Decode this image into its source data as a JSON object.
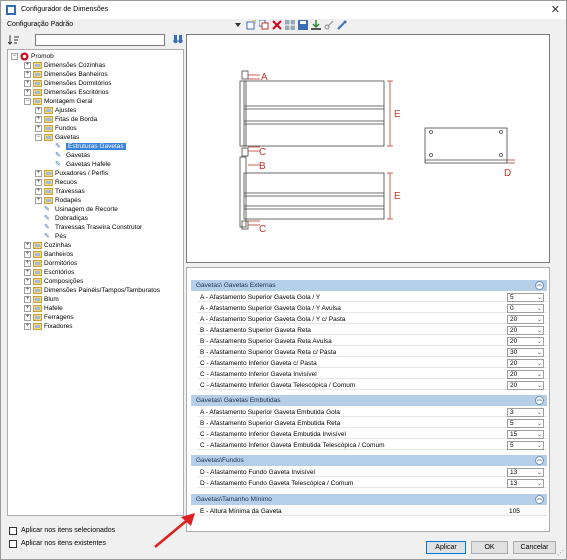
{
  "window": {
    "title": "Configurador de Dimensões",
    "close_glyph": "✕"
  },
  "menu": {
    "label": "Configuração Padrão"
  },
  "toolbar": {
    "icons": [
      "dropdown-arrow-icon",
      "new-icon",
      "copy-icon",
      "delete-icon",
      "grid-icon",
      "save-icon",
      "import-icon",
      "key-icon",
      "tools-icon"
    ]
  },
  "search": {
    "value": "",
    "placeholder": ""
  },
  "tree": {
    "root": "Promob",
    "n1": "Dimensões Cozinhas",
    "n2": "Dimensões Banheiros",
    "n3": "Dimensões Dormitórios",
    "n4": "Dimensões Escritórios",
    "n5": "Montagem Geral",
    "n6": "Ajustes",
    "n7": "Fitas de Borda",
    "n8": "Fundos",
    "n9": "Gavetas",
    "n10": "Estruturas Gavetas",
    "n11": "Gavetas",
    "n12": "Gavetas Hafele",
    "n13": "Puxadores / Perfis",
    "n14": "Recuos",
    "n15": "Travessas",
    "n16": "Rodapés",
    "n17": "Usinagem de Recorte",
    "n18": "Dobradiças",
    "n19": "Travessas Traseira Construtor",
    "n20": "Pés",
    "n21": "Cozinhas",
    "n22": "Banheiros",
    "n23": "Dormitórios",
    "n24": "Escritórios",
    "n25": "Composições",
    "n26": "Dimensões Painéis/Tampos/Tamburatos",
    "n27": "Blum",
    "n28": "Hafele",
    "n29": "Ferragens",
    "n30": "Fixadores"
  },
  "checkboxes": {
    "selected_label": "Aplicar nos itens selecionados",
    "existing_label": "Aplicar nos itens existentes"
  },
  "preview": {
    "label_a": "A",
    "label_b": "B",
    "label_c1": "C",
    "label_c2": "C",
    "label_d": "D",
    "label_e1": "E",
    "label_e2": "E"
  },
  "sections": {
    "s1": {
      "title": "Gavetas\\ Gavetas Externas",
      "rows": [
        {
          "label": "A - Afastamento Superior Gaveta Gola / Y",
          "value": "5"
        },
        {
          "label": "A - Afastamento Superior Gaveta Gola / Y Avulsa",
          "value": "0"
        },
        {
          "label": "A - Afastamento Superior Gaveta Gola / Y c/ Pasta",
          "value": "20"
        },
        {
          "label": "B - Afastamento Superior Gaveta Reta",
          "value": "20"
        },
        {
          "label": "B - Afastamento Superior Gaveta Reta Avulsa",
          "value": "20"
        },
        {
          "label": "B - Afastamento Superior Gaveta Reta c/ Pasta",
          "value": "30"
        },
        {
          "label": "C - Afastamento Inferior Gaveta c/ Pasta",
          "value": "20"
        },
        {
          "label": "C - Afastamento Inferior Gaveta Invisível",
          "value": "20"
        },
        {
          "label": "C - Afastamento Inferior Gaveta Telescópica / Comum",
          "value": "20"
        }
      ]
    },
    "s2": {
      "title": "Gavetas\\ Gavetas Embutidas",
      "rows": [
        {
          "label": "A - Afastamento Superior Gaveta Embutida Gola",
          "value": "3"
        },
        {
          "label": "B - Afastamento Superior Gaveta Embutida Reta",
          "value": "5"
        },
        {
          "label": "C - Afastamento Inferior Gaveta Embutida Invisível",
          "value": "15"
        },
        {
          "label": "C - Afastamento Inferior Gaveta Embutida Telescópica / Comum",
          "value": "5"
        }
      ]
    },
    "s3": {
      "title": "Gavetas\\Fundos",
      "rows": [
        {
          "label": "D - Afastamento Fundo Gaveta Invisível",
          "value": "13"
        },
        {
          "label": "D - Afastamento Fundo Gaveta Telescópica / Comum",
          "value": "13"
        }
      ]
    },
    "s4": {
      "title": "Gavetas\\Tamanho Mínimo",
      "rows": [
        {
          "label": "E - Altura Mínima da Gaveta",
          "value": "105"
        }
      ]
    },
    "collapse_glyph": "︽",
    "dropdown_glyph": "⌄"
  },
  "buttons": {
    "apply": "Aplicar",
    "ok": "OK",
    "cancel": "Cancelar"
  },
  "colors": {
    "section_header": "#b6cfe9",
    "selected_item": "#3c82d8",
    "dimension_label": "#c0392b",
    "arrow": "#e02020"
  }
}
